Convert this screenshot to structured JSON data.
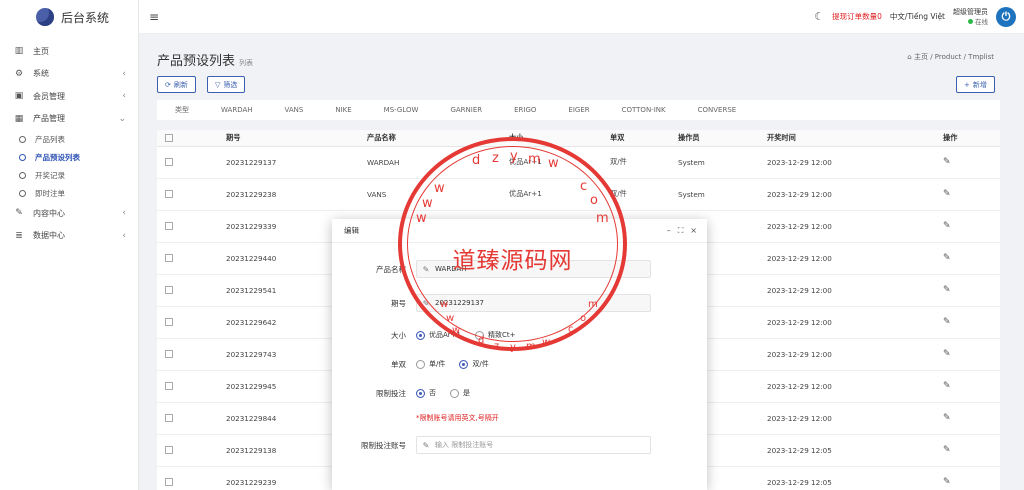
{
  "app": {
    "title": "后台系统"
  },
  "sidebar": {
    "items": [
      {
        "label": "主页",
        "icon": "bar-chart-icon",
        "chev": ""
      },
      {
        "label": "系统",
        "icon": "gear-icon",
        "chev": "‹"
      },
      {
        "label": "会员管理",
        "icon": "id-card-icon",
        "chev": "‹"
      },
      {
        "label": "产品管理",
        "icon": "grid-icon",
        "chev": "⌄"
      }
    ],
    "subitems": [
      "产品列表",
      "产品预设列表",
      "开奖记录",
      "即时注单"
    ],
    "items2": [
      {
        "label": "内容中心",
        "icon": "comment-icon"
      },
      {
        "label": "数据中心",
        "icon": "database-icon"
      }
    ]
  },
  "topbar": {
    "alert": "提现订单数量0",
    "lang": "中文/Tiếng Việt",
    "admin": "超级管理员",
    "status": "在线"
  },
  "page": {
    "title": "产品预设列表",
    "subtitle": "列表",
    "crumb_home": "主页",
    "crumb_1": "Product",
    "crumb_2": "Tmplist"
  },
  "toolbar": {
    "refresh": "刷新",
    "filter": "筛选",
    "add": "新增"
  },
  "filters": [
    "类型",
    "WARDAH",
    "VANS",
    "NIKE",
    "MS-GLOW",
    "GARNIER",
    "ERIGO",
    "EIGER",
    "COTTON-INK",
    "CONVERSE"
  ],
  "table": {
    "headers": [
      "期号",
      "产品名称",
      "大小",
      "单双",
      "操作员",
      "开奖时间",
      "操作"
    ],
    "rows": [
      [
        "20231229137",
        "WARDAH",
        "优品Ar+1",
        "双/件",
        "System",
        "2023-12-29 12:00"
      ],
      [
        "20231229238",
        "VANS",
        "优品Ar+1",
        "双/件",
        "System",
        "2023-12-29 12:00"
      ],
      [
        "20231229339",
        "",
        "",
        "",
        "",
        "2023-12-29 12:00"
      ],
      [
        "20231229440",
        "",
        "",
        "",
        "",
        "2023-12-29 12:00"
      ],
      [
        "20231229541",
        "",
        "",
        "",
        "",
        "2023-12-29 12:00"
      ],
      [
        "20231229642",
        "",
        "",
        "",
        "",
        "2023-12-29 12:00"
      ],
      [
        "20231229743",
        "",
        "",
        "",
        "",
        "2023-12-29 12:00"
      ],
      [
        "20231229945",
        "",
        "",
        "",
        "",
        "2023-12-29 12:00"
      ],
      [
        "20231229844",
        "",
        "",
        "",
        "",
        "2023-12-29 12:00"
      ],
      [
        "20231229138",
        "",
        "",
        "",
        "",
        "2023-12-29 12:05"
      ],
      [
        "20231229239",
        "",
        "",
        "",
        "",
        "2023-12-29 12:05"
      ]
    ]
  },
  "modal": {
    "title": "编辑",
    "labels": {
      "product": "产品名称",
      "period": "期号",
      "size": "大小",
      "parity": "单双",
      "limit": "限制投注",
      "limit_acct": "限制投注账号"
    },
    "product_value": "WARDAH",
    "period_value": "20231229137",
    "size_opts": [
      "优品Ar+1",
      "精致Ct+"
    ],
    "parity_opts": [
      "单/件",
      "双/件"
    ],
    "limit_opts": [
      "否",
      "是"
    ],
    "hint": "*限制账号请用英文,号隔开",
    "acct_placeholder": "输入 限制投注账号"
  },
  "watermark": {
    "text": "道臻源码网",
    "top": "dzym.w",
    "bottom": "www.dzym.com"
  }
}
